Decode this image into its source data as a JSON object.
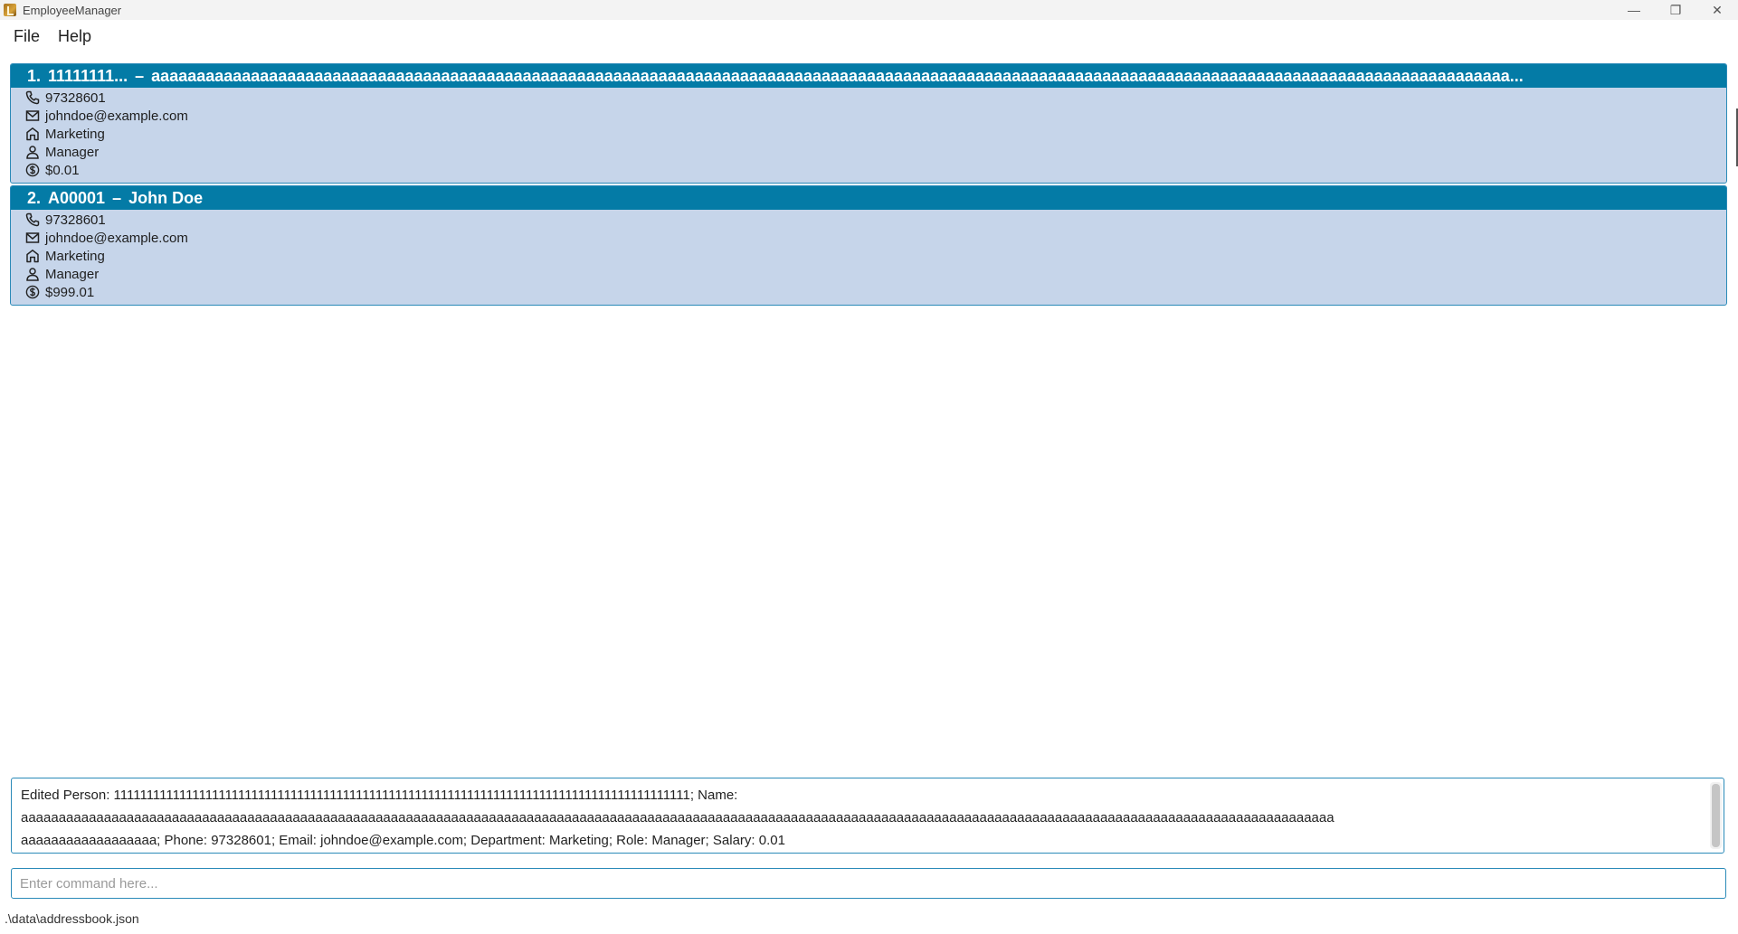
{
  "window": {
    "title": "EmployeeManager",
    "controls": {
      "minimize": "—",
      "maximize": "❐",
      "close": "✕"
    }
  },
  "menu": {
    "file": "File",
    "help": "Help"
  },
  "persons": [
    {
      "index": "1.",
      "id": "11111111...",
      "name": "aaaaaaaaaaaaaaaaaaaaaaaaaaaaaaaaaaaaaaaaaaaaaaaaaaaaaaaaaaaaaaaaaaaaaaaaaaaaaaaaaaaaaaaaaaaaaaaaaaaaaaaaaaaaaaaaaaaaaaaaaaaaaaaaaaaaaaaaaaaaaaaaaaaaaa...",
      "phone": "97328601",
      "email": "johndoe@example.com",
      "department": "Marketing",
      "role": "Manager",
      "salary": "$0.01"
    },
    {
      "index": "2.",
      "id": "A00001",
      "name": "John Doe",
      "phone": "97328601",
      "email": "johndoe@example.com",
      "department": "Marketing",
      "role": "Manager",
      "salary": "$999.01"
    }
  ],
  "dash": "–",
  "icons": {
    "phone": "phone-icon",
    "email": "mail-icon",
    "department": "building-icon",
    "role": "person-icon",
    "salary": "dollar-icon"
  },
  "result": {
    "line1": "Edited Person: 1111111111111111111111111111111111111111111111111111111111111111111111111111111111111111; Name:",
    "line2": "aaaaaaaaaaaaaaaaaaaaaaaaaaaaaaaaaaaaaaaaaaaaaaaaaaaaaaaaaaaaaaaaaaaaaaaaaaaaaaaaaaaaaaaaaaaaaaaaaaaaaaaaaaaaaaaaaaaaaaaaaaaaaaaaaaaaaaaaaaaaaaaaaaaaaaaaaaaaaaaaaaaaaaaaaaaaaa",
    "line3": "aaaaaaaaaaaaaaaaaa; Phone: 97328601; Email: johndoe@example.com; Department: Marketing; Role: Manager; Salary: 0.01"
  },
  "command": {
    "placeholder": "Enter command here...",
    "value": ""
  },
  "status": {
    "file_path": ".\\data\\addressbook.json"
  },
  "colors": {
    "header_bg": "#047ba6",
    "card_bg": "#c6d5ea",
    "border": "#2a8ab8"
  }
}
